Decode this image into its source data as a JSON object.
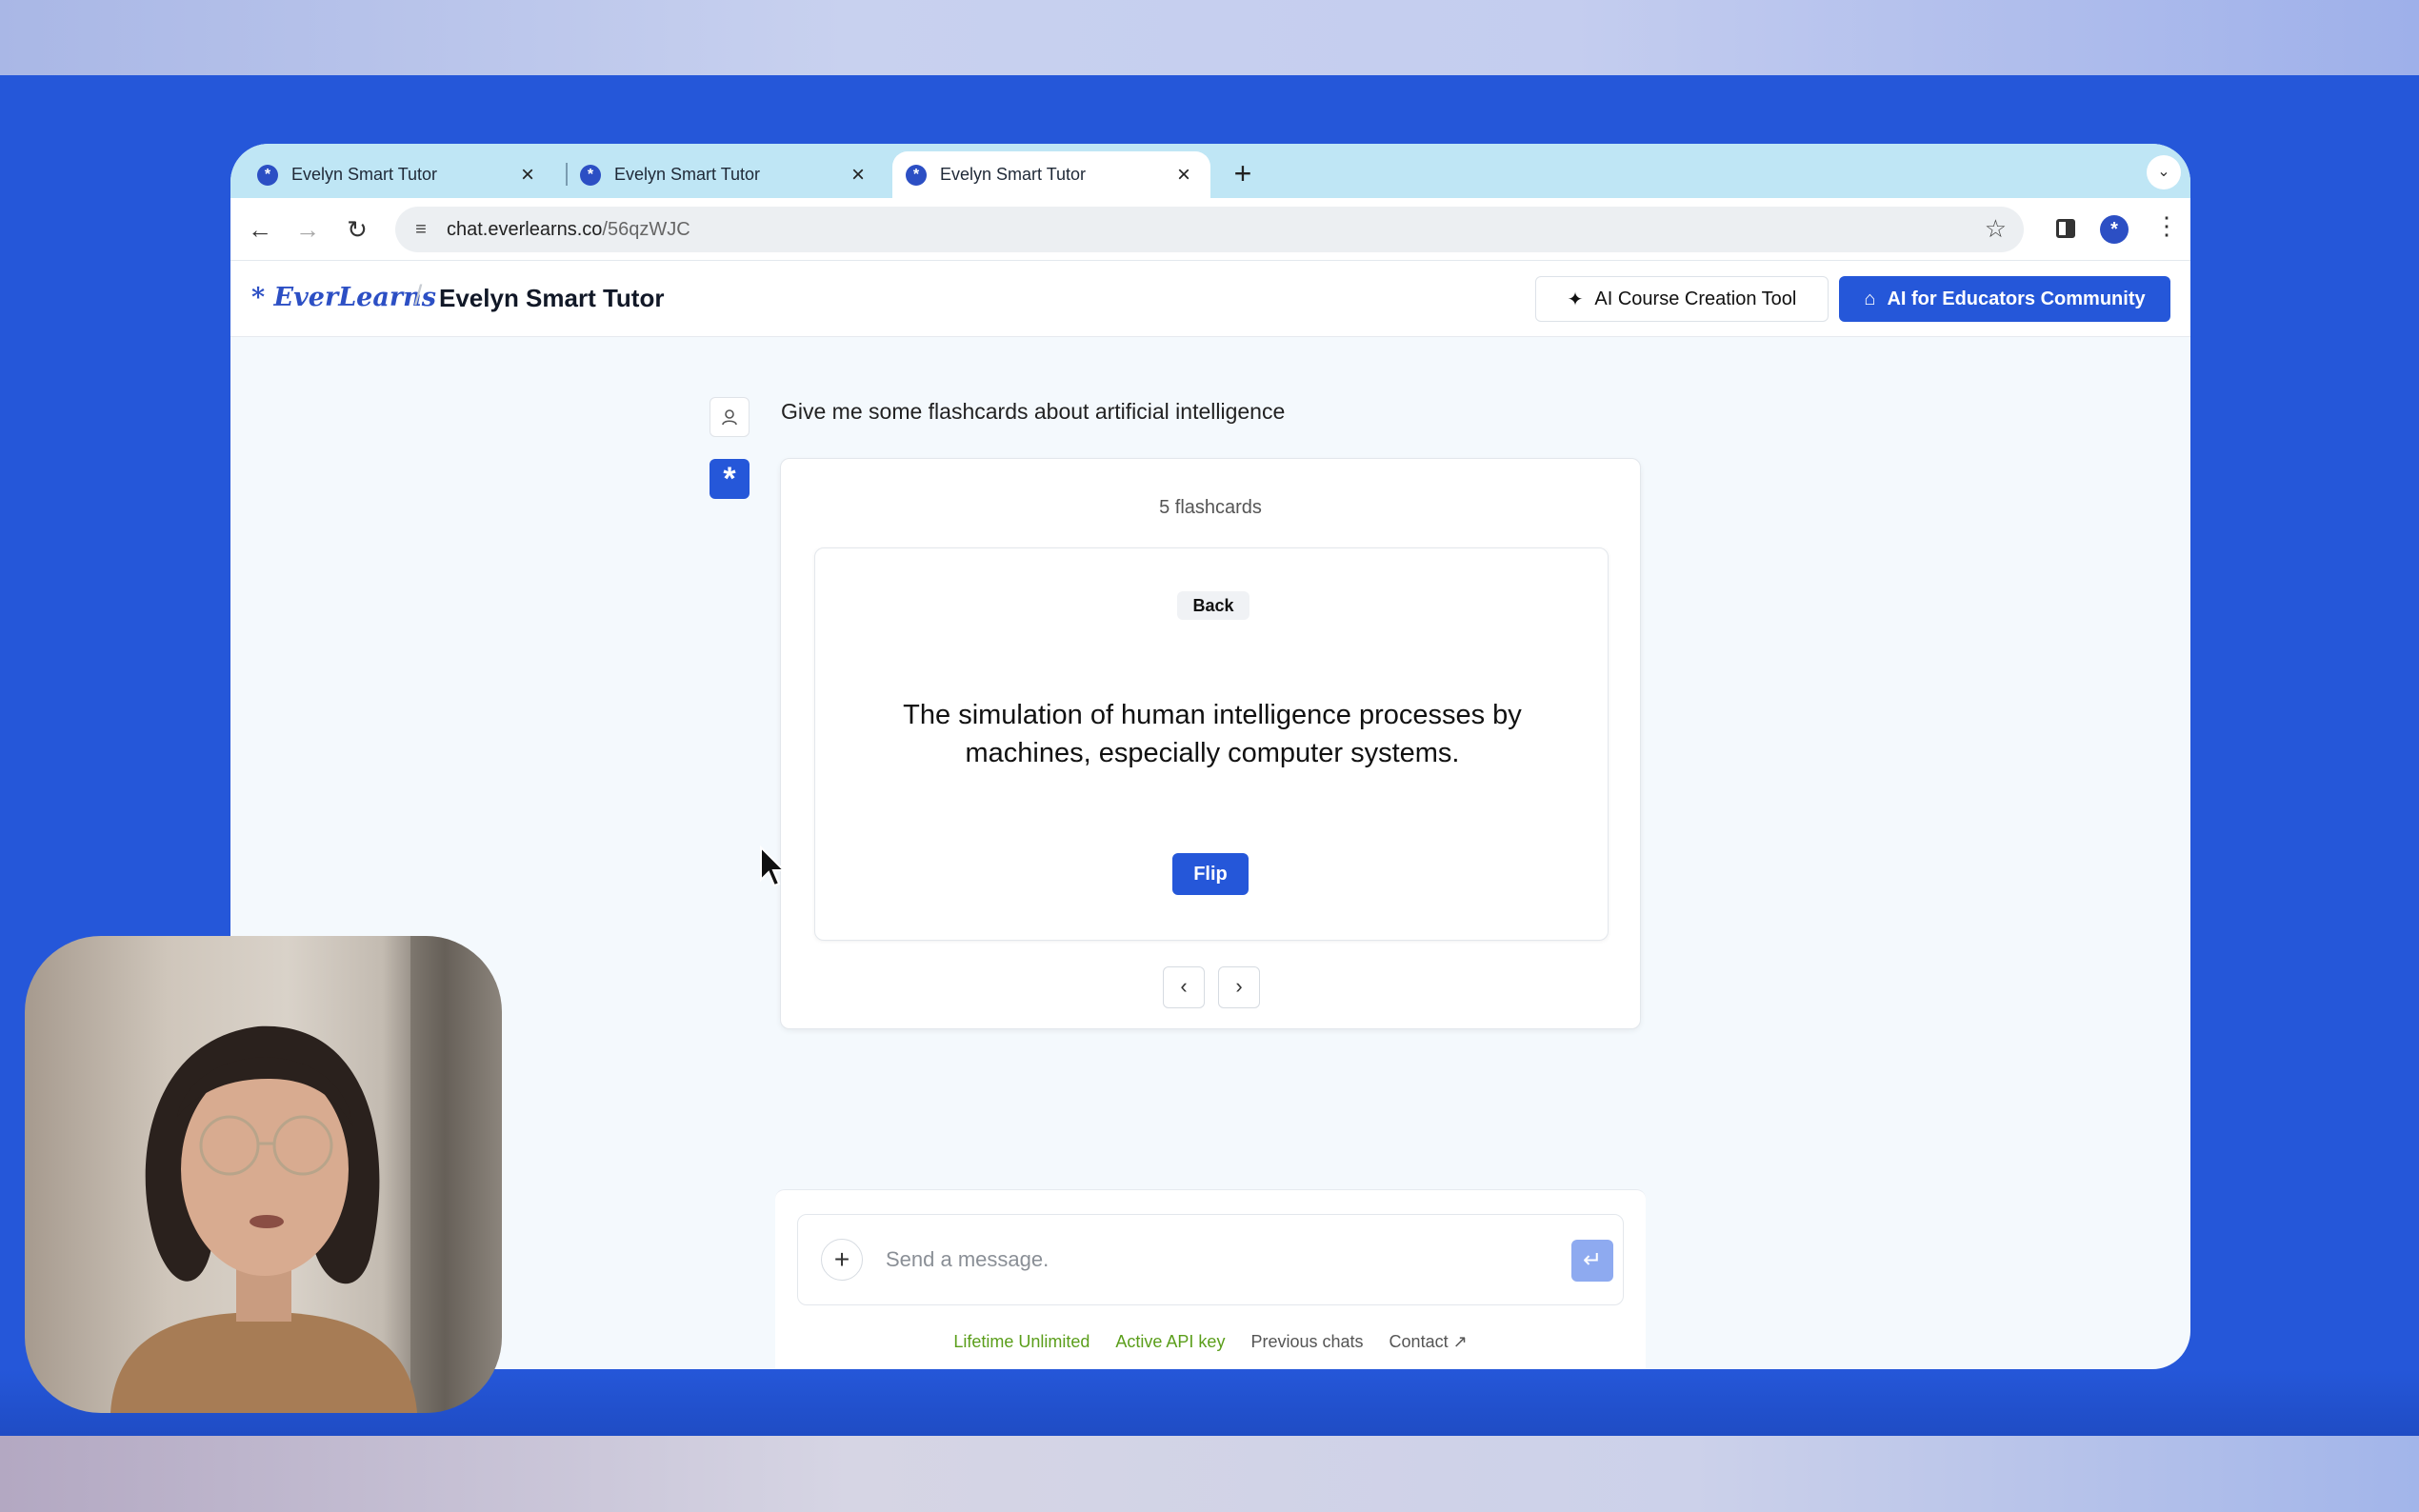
{
  "browser": {
    "tabs": [
      {
        "title": "Evelyn Smart Tutor",
        "active": false
      },
      {
        "title": "Evelyn Smart Tutor",
        "active": false
      },
      {
        "title": "Evelyn Smart Tutor",
        "active": true
      }
    ],
    "tab_close_glyph": "×",
    "new_tab_glyph": "+",
    "url_host": "chat.everlearns.co",
    "url_path": "/56qzWJC"
  },
  "app": {
    "logo": "* EverLearns",
    "crumb_sep": "/",
    "page_title": "Evelyn Smart Tutor",
    "course_tool_label": "AI Course Creation Tool",
    "community_label": "AI for Educators Community"
  },
  "chat": {
    "user_message": "Give me some flashcards about artificial intelligence",
    "flashcards": {
      "count_label": "5 flashcards",
      "side_label": "Back",
      "text": "The simulation of human intelligence processes by machines, especially computer systems.",
      "flip_label": "Flip"
    }
  },
  "composer": {
    "placeholder": "Send a message.",
    "links": [
      "Lifetime Unlimited",
      "Active API key",
      "Previous chats",
      "Contact ↗"
    ]
  },
  "colors": {
    "accent": "#2557d9",
    "tabstrip": "#bfe6f5",
    "footer_green": "#5a9e1a"
  }
}
